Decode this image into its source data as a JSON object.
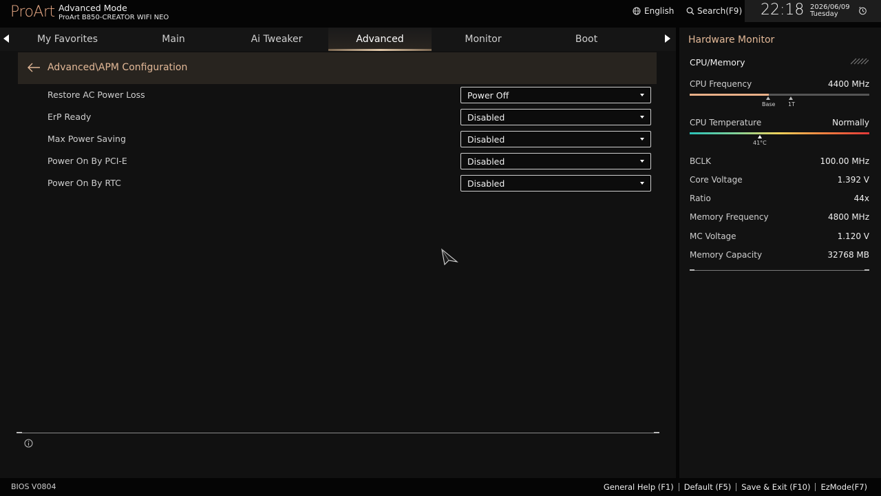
{
  "header": {
    "brand": "ProArt",
    "mode": "Advanced Mode",
    "model": "ProArt B850-CREATOR WIFI NEO",
    "language": "English",
    "search": "Search(F9)",
    "time": "22:18",
    "date": "2026/06/09",
    "day": "Tuesday"
  },
  "tabs": [
    {
      "label": "My Favorites"
    },
    {
      "label": "Main"
    },
    {
      "label": "Ai Tweaker"
    },
    {
      "label": "Advanced"
    },
    {
      "label": "Monitor"
    },
    {
      "label": "Boot"
    }
  ],
  "active_tab": "Advanced",
  "breadcrumb": "Advanced\\APM Configuration",
  "settings": [
    {
      "label": "Restore AC Power Loss",
      "value": "Power Off"
    },
    {
      "label": "ErP Ready",
      "value": "Disabled"
    },
    {
      "label": "Max Power Saving",
      "value": "Disabled"
    },
    {
      "label": "Power On By PCI-E",
      "value": "Disabled"
    },
    {
      "label": "Power On By RTC",
      "value": "Disabled"
    }
  ],
  "hardware_monitor": {
    "title": "Hardware Monitor",
    "section": "CPU/Memory",
    "cpu_frequency": {
      "label": "CPU Frequency",
      "value": "4400 MHz",
      "level": 0.44,
      "marker_base": "Base",
      "marker_1t": "1T"
    },
    "cpu_temperature": {
      "label": "CPU Temperature",
      "value": "Normally",
      "reading": "41°C"
    },
    "stats": [
      {
        "label": "BCLK",
        "value": "100.00 MHz"
      },
      {
        "label": "Core Voltage",
        "value": "1.392 V"
      },
      {
        "label": "Ratio",
        "value": "44x"
      },
      {
        "label": "Memory Frequency",
        "value": "4800 MHz"
      },
      {
        "label": "MC Voltage",
        "value": "1.120 V"
      },
      {
        "label": "Memory Capacity",
        "value": "32768 MB"
      }
    ]
  },
  "footer": {
    "bios_version": "BIOS V0804",
    "general_help": "General Help (F1)",
    "default": "Default (F5)",
    "save_exit": "Save & Exit (F10)",
    "ezmode": "EzMode(F7)"
  },
  "colors": {
    "accent": "#e2b897",
    "active_tab_underline": "#e0c7a8",
    "breadcrumb_bg": "#28241f"
  }
}
